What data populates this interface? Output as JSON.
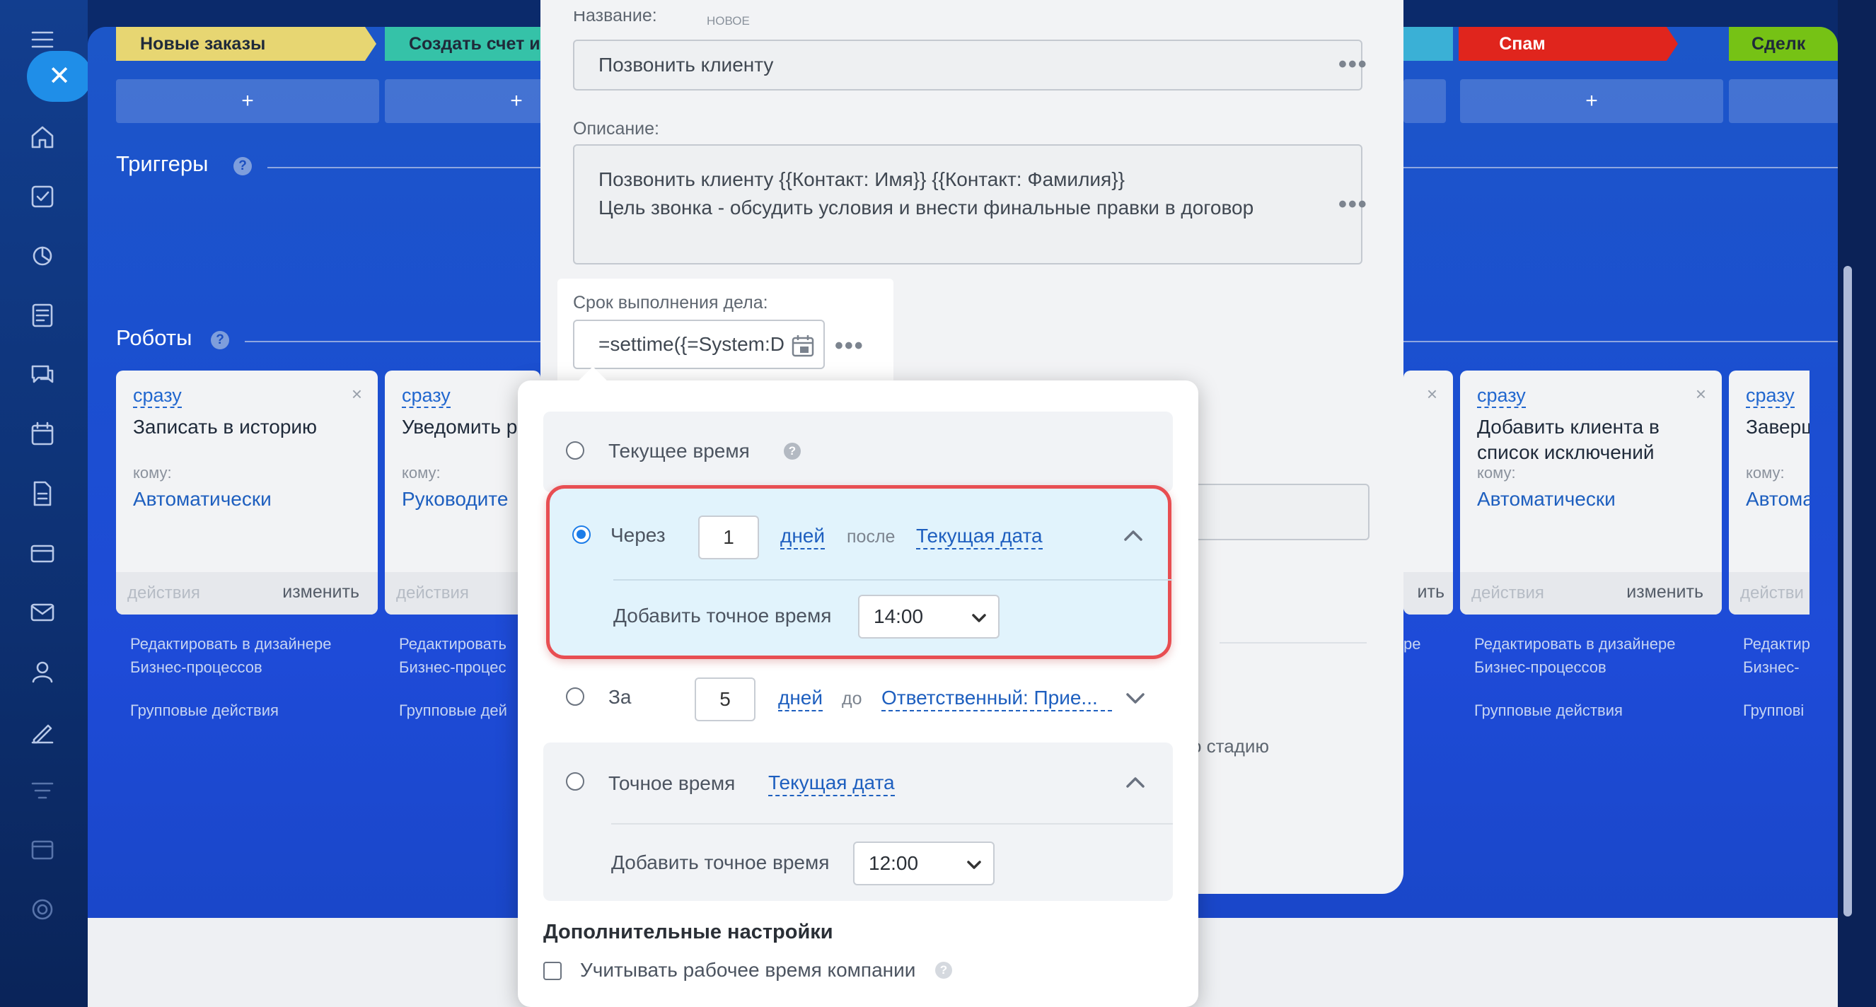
{
  "stages": [
    {
      "label": "Новые заказы",
      "color": "#e7d672"
    },
    {
      "label": "Создать счет и",
      "color": "#35c2a8"
    },
    {
      "label": "Спам",
      "color": "#e0251d"
    },
    {
      "label": "Сделк",
      "color": "#76c215"
    }
  ],
  "plus_label": "+",
  "triggers": {
    "title": "Триггеры",
    "help": "?"
  },
  "robots": {
    "title": "Роботы",
    "help": "?",
    "cards": [
      {
        "when": "сразу",
        "title": "Записать в историю",
        "to_label": "кому:",
        "to_value": "Автоматически",
        "actions": "действия",
        "edit": "изменить",
        "links": [
          "Редактировать в дизайнере",
          "Бизнес-процессов"
        ],
        "group": "Групповые действия",
        "close": "×"
      },
      {
        "when": "сразу",
        "title": "Уведомить р",
        "to_label": "кому:",
        "to_value": "Руководите",
        "actions": "действия",
        "edit": "",
        "links": [
          "Редактировать",
          "Бизнес-процес"
        ],
        "group": "Групповые дей",
        "close": ""
      },
      {
        "when": "сразу",
        "title": "Добавить клиента в список исключений",
        "to_label": "кому:",
        "to_value": "Автоматически",
        "actions": "действия",
        "edit": "изменить",
        "links": [
          "Редактировать в дизайнере",
          "Бизнес-процессов"
        ],
        "group": "Групповые действия",
        "close": "×"
      },
      {
        "when": "сразу",
        "title": "Заверш",
        "to_label": "кому:",
        "to_value": "Автома",
        "actions": "действи",
        "edit": "",
        "links": [
          "Редактир",
          "Бизнес-"
        ],
        "group": "Группові",
        "close": ""
      }
    ],
    "partial": {
      "close": "×",
      "edit": "ить",
      "link": "ре"
    }
  },
  "panel": {
    "top_fragment": "НОВОЕ",
    "name_label": "Название:",
    "name_value": "Позвонить клиенту",
    "desc_label": "Описание:",
    "desc_lines": [
      "Позвонить клиенту {{Контакт: Имя}} {{Контакт: Фамилия}}",
      "Цель звонка - обсудить условия и внести финальные правки в договор"
    ],
    "deadline_label": "Срок выполнения дела:",
    "deadline_value": "=settime({=System:D",
    "stage_fragment": "о стадию",
    "more": "•••"
  },
  "popup": {
    "current_time": {
      "label": "Текущее время",
      "help": "?"
    },
    "after": {
      "label": "Через",
      "value": "1",
      "unit": "дней",
      "relation": "после",
      "base": "Текущая дата",
      "exact_label": "Добавить точное время",
      "exact_time": "14:00",
      "selected": true
    },
    "before": {
      "label": "За",
      "value": "5",
      "unit": "дней",
      "relation": "до",
      "base": "Ответственный: Прие..."
    },
    "exact": {
      "label": "Точное время",
      "base": "Текущая дата",
      "exact_label": "Добавить точное время",
      "exact_time": "12:00"
    },
    "extra_title": "Дополнительные настройки",
    "work_time_label": "Учитывать рабочее время компании",
    "work_time_help": "?"
  },
  "colors": {
    "accent": "#1d7de8",
    "highlight_border": "#e84e52",
    "link": "#1e5fbf"
  }
}
